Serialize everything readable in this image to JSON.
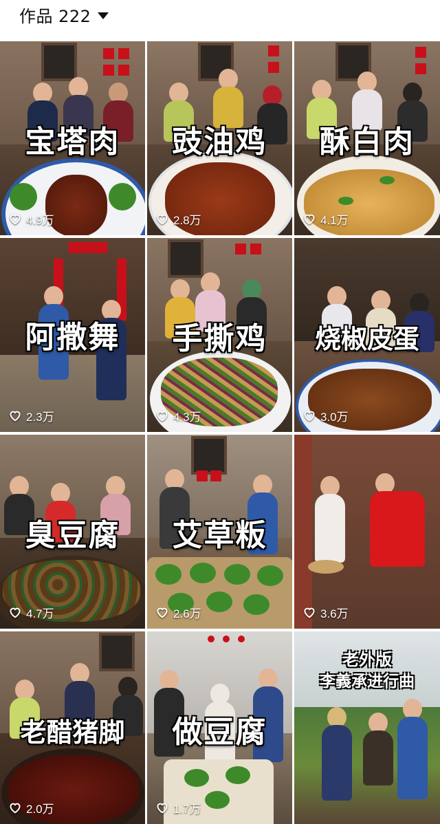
{
  "header": {
    "works_label": "作品 222"
  },
  "colors": {
    "caption_fill": "#ffffff",
    "caption_stroke": "#111111",
    "couplet_red": "#c8101a"
  },
  "videos": [
    {
      "caption": "宝塔肉",
      "likes": "4.9万"
    },
    {
      "caption": "豉油鸡",
      "likes": "2.8万"
    },
    {
      "caption": "酥白肉",
      "likes": "4.1万"
    },
    {
      "caption": "阿撒舞",
      "likes": "2.3万"
    },
    {
      "caption": "手撕鸡",
      "likes": "4.3万"
    },
    {
      "caption": "烧椒皮蛋",
      "likes": "3.0万"
    },
    {
      "caption": "臭豆腐",
      "likes": "4.7万"
    },
    {
      "caption": "艾草粄",
      "likes": "2.6万"
    },
    {
      "caption": "",
      "likes": "3.6万"
    },
    {
      "caption": "老醋猪脚",
      "likes": "2.0万"
    },
    {
      "caption": "做豆腐",
      "likes": "1.7万"
    },
    {
      "caption": "",
      "likes": "",
      "title_line1": "老外版",
      "title_line2": "李義承进行曲"
    }
  ],
  "icons": {
    "dropdown": "caret-down-icon",
    "like": "heart-outline-icon"
  }
}
